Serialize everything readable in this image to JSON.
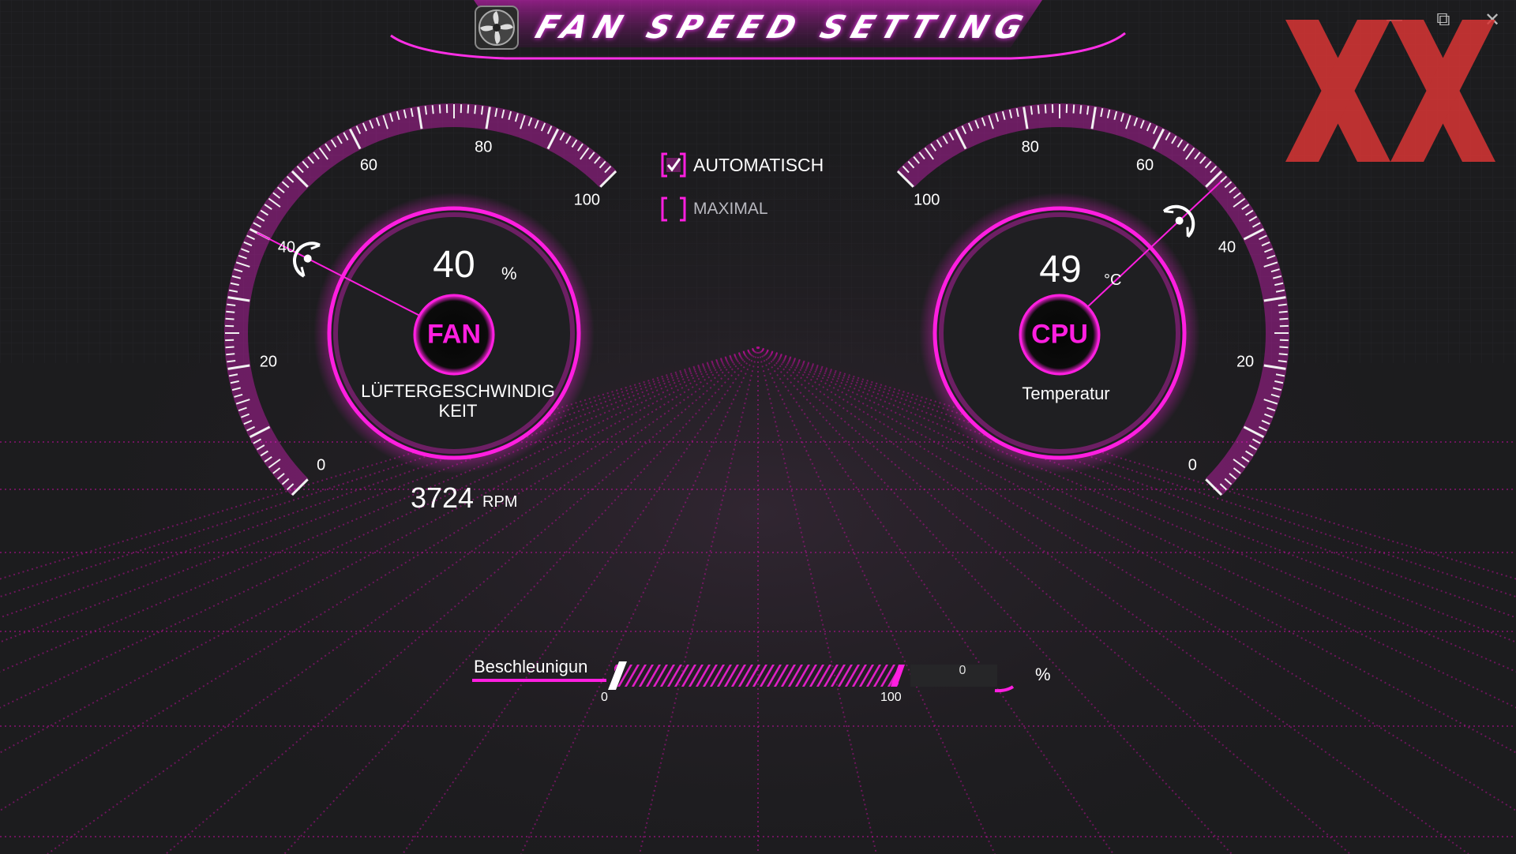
{
  "window": {
    "title": "FAN SPEED SETTING",
    "minimize_label": "—",
    "restore_label": "⧉",
    "close_label": "✕",
    "accent": "#ff1fe0",
    "background": "#1c1c1e"
  },
  "fan_gauge": {
    "value": "40",
    "unit": "%",
    "center_label": "FAN",
    "caption_line1": "LÜFTERGESCHWINDIG",
    "caption_line2": "KEIT",
    "rpm_value": "3724",
    "rpm_unit": "RPM",
    "reading": 40,
    "scale_max": 100,
    "tick_labels": [
      "0",
      "20",
      "40",
      "60",
      "80",
      "100"
    ]
  },
  "cpu_gauge": {
    "value": "49",
    "unit": "°C",
    "center_label": "CPU",
    "caption": "Temperatur",
    "reading": 49,
    "scale_max": 100,
    "tick_labels": [
      "0",
      "20",
      "40",
      "60",
      "80",
      "100"
    ]
  },
  "mode": {
    "automatic_label": "AUTOMATISCH",
    "automatic_checked": true,
    "maximal_label": "MAXIMAL",
    "maximal_checked": false
  },
  "boost": {
    "label": "Beschleunigun",
    "value": "0",
    "unit": "%",
    "min_label": "0",
    "max_label": "100",
    "level": 0
  },
  "watermark": {
    "icon": "xx-logo-icon",
    "color": "#d93535"
  }
}
